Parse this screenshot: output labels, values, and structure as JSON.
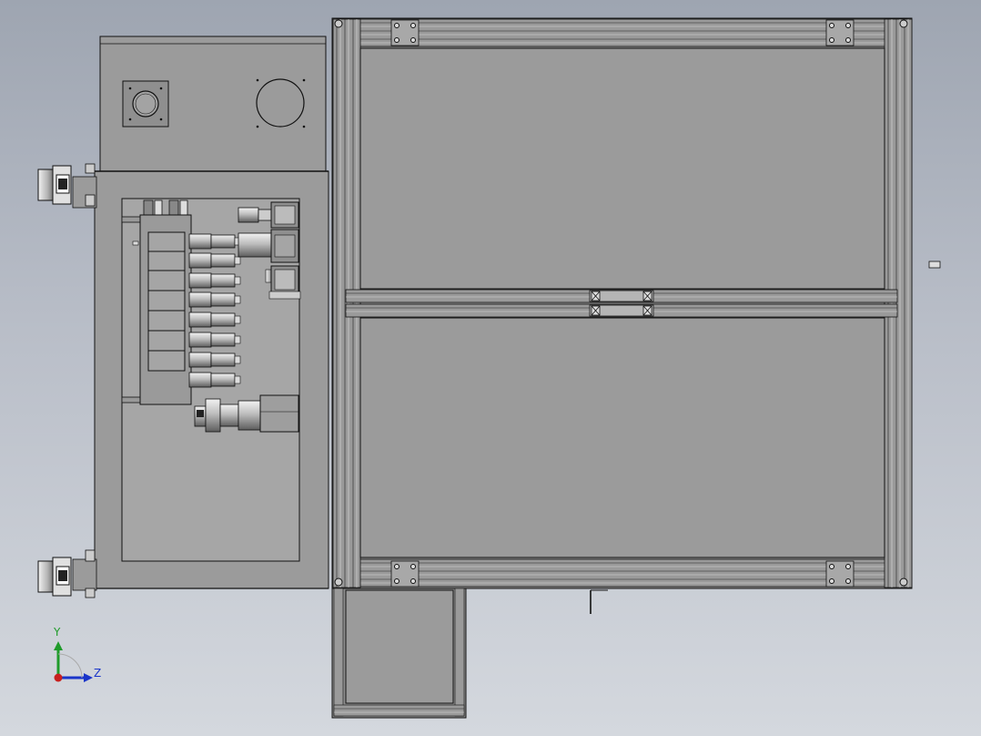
{
  "viewport": {
    "background_top": "#9ea5b1",
    "background_bottom": "#d4d8de"
  },
  "model": {
    "name": "assembly-top-view",
    "colors": {
      "sheet_metal": "#9b9b9b",
      "profile": "#8e8e8e",
      "edge": "#111111",
      "highlight": "#dcdcdc"
    }
  },
  "triad": {
    "y_label": "Y",
    "z_label": "Z",
    "y_color": "#1f9b2a",
    "z_color": "#1a35c9",
    "x_color": "#c8201e"
  }
}
